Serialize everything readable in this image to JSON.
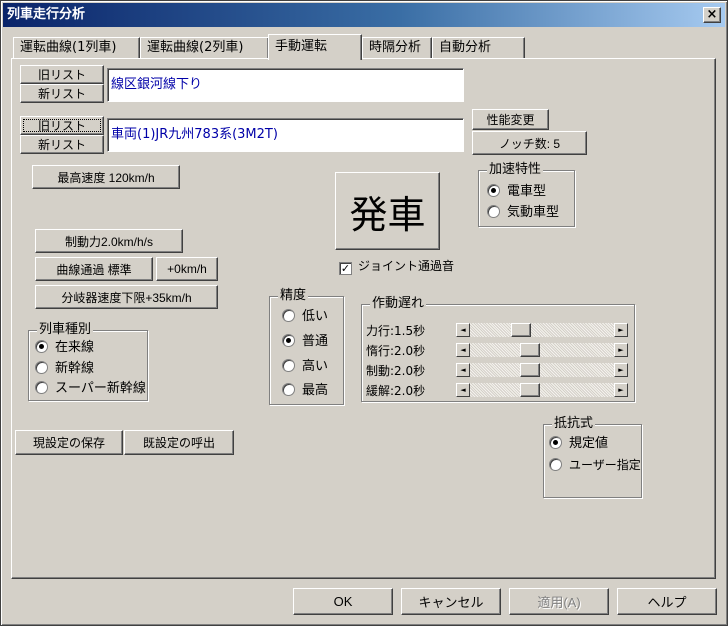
{
  "window": {
    "title": "列車走行分析",
    "close_glyph": "×"
  },
  "tabs": [
    {
      "label": "運転曲線(1列車)"
    },
    {
      "label": "運転曲線(2列車)"
    },
    {
      "label": "手動運転"
    },
    {
      "label": "時隔分析"
    },
    {
      "label": "自動分析"
    }
  ],
  "route": {
    "old_list": "旧リスト",
    "new_list": "新リスト",
    "value": "線区銀河線下り"
  },
  "vehicle": {
    "old_list": "旧リスト",
    "new_list": "新リスト",
    "value": "車両(1)JR九州783系(3M2T)",
    "performance_change": "性能変更",
    "notch_count": "ノッチ数: 5"
  },
  "max_speed": "最高速度 120km/h",
  "depart": "発車",
  "joint_sound": {
    "label": "ジョイント通過音",
    "checked": true,
    "check_glyph": "✓"
  },
  "accel": {
    "title": "加速特性",
    "options": [
      "電車型",
      "気動車型"
    ],
    "selected": 0
  },
  "brake_force": "制動力2.0km/h/s",
  "curve_pass": {
    "label": "曲線通過 標準",
    "plus": "+0km/h"
  },
  "turnout": "分岐器速度下限+35km/h",
  "precision": {
    "title": "精度",
    "options": [
      "低い",
      "普通",
      "高い",
      "最高"
    ],
    "selected": 1
  },
  "delay": {
    "title": "作動遅れ",
    "rows": [
      {
        "label": "力行:1.5秒",
        "position": 0.33
      },
      {
        "label": "惰行:2.0秒",
        "position": 0.4
      },
      {
        "label": "制動:2.0秒",
        "position": 0.4
      },
      {
        "label": "緩解:2.0秒",
        "position": 0.4
      }
    ],
    "left_arrow": "◄",
    "right_arrow": "►"
  },
  "train_type": {
    "title": "列車種別",
    "options": [
      "在来線",
      "新幹線",
      "スーパー新幹線"
    ],
    "selected": 0
  },
  "save_settings": "現設定の保存",
  "load_settings": "既設定の呼出",
  "resistance": {
    "title": "抵抗式",
    "options": [
      "規定値",
      "ユーザー指定"
    ],
    "selected": 0
  },
  "footer": {
    "ok": "OK",
    "cancel": "キャンセル",
    "apply": "適用(A)",
    "help": "ヘルプ"
  }
}
